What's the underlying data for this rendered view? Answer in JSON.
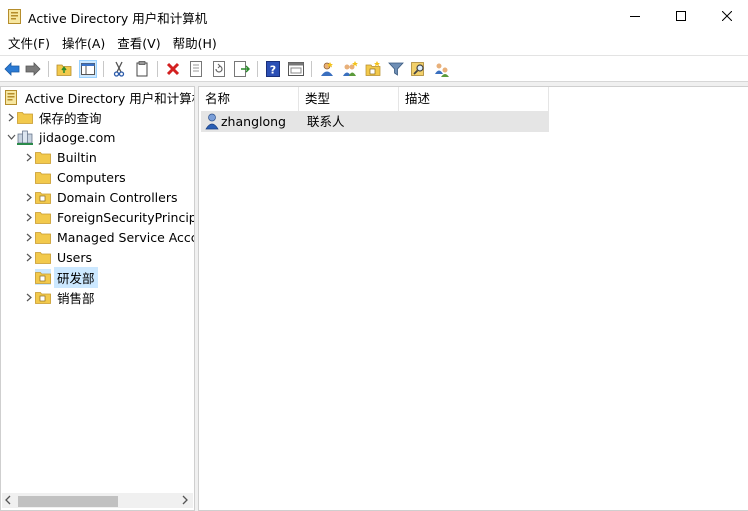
{
  "window": {
    "title": "Active Directory 用户和计算机",
    "controls": [
      "minimize",
      "maximize",
      "close"
    ]
  },
  "menu": [
    {
      "label": "文件(F)"
    },
    {
      "label": "操作(A)"
    },
    {
      "label": "查看(V)"
    },
    {
      "label": "帮助(H)"
    }
  ],
  "toolbar": {
    "icons": [
      "back-icon",
      "forward-icon",
      "up-folder-icon",
      "show-hide-tree-icon",
      "cut-icon",
      "copy-icon",
      "delete-icon",
      "properties-icon",
      "refresh-icon",
      "export-list-icon",
      "help-icon",
      "console-icon",
      "new-user-icon",
      "new-group-icon",
      "new-ou-icon",
      "filter-icon",
      "find-icon",
      "delegate-icon"
    ]
  },
  "tree": {
    "root": "Active Directory 用户和计算机",
    "saved_queries": "保存的查询",
    "domain": "jidaoge.com",
    "children": [
      {
        "label": "Builtin"
      },
      {
        "label": "Computers"
      },
      {
        "label": "Domain Controllers"
      },
      {
        "label": "ForeignSecurityPrincipa"
      },
      {
        "label": "Managed Service Accc"
      },
      {
        "label": "Users"
      },
      {
        "label": "研发部"
      },
      {
        "label": "销售部"
      }
    ],
    "selected": "研发部"
  },
  "list": {
    "columns": [
      {
        "label": "名称"
      },
      {
        "label": "类型"
      },
      {
        "label": "描述"
      }
    ],
    "rows": [
      {
        "name": "zhanglong",
        "type": "联系人",
        "description": ""
      }
    ]
  }
}
